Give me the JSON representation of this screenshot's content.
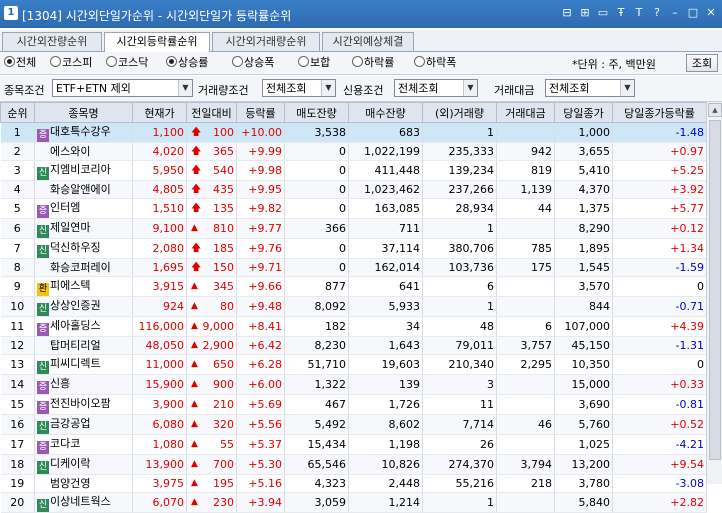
{
  "window": {
    "num": "1",
    "title": "[1304] 시간외단일가순위 - 시간외단일가 등락률순위",
    "controls": [
      "⊟",
      "⊞",
      "▭",
      "Ŧ",
      "T",
      "?",
      "–",
      "□",
      "✕"
    ]
  },
  "tabs": [
    {
      "label": "시간외잔량순위",
      "active": false
    },
    {
      "label": "시간외등락률순위",
      "active": true
    },
    {
      "label": "시간외거래량순위",
      "active": false
    },
    {
      "label": "시간외예상체결",
      "active": false
    }
  ],
  "market_radios": [
    {
      "label": "전체",
      "on": true
    },
    {
      "label": "코스피",
      "on": false
    },
    {
      "label": "코스닥",
      "on": false
    }
  ],
  "sort_radios": [
    {
      "label": "상승률",
      "on": true
    },
    {
      "label": "상승폭",
      "on": false
    },
    {
      "label": "보합",
      "on": false
    },
    {
      "label": "하락률",
      "on": false
    },
    {
      "label": "하락폭",
      "on": false
    }
  ],
  "unit_text": "*단위 : 주, 백만원",
  "query_button": "조회",
  "filters": {
    "stock_cond_label": "종목조건",
    "stock_cond_value": "ETF+ETN 제외",
    "volume_cond_label": "거래량조건",
    "volume_cond_value": "전체조회",
    "credit_cond_label": "신용조건",
    "credit_cond_value": "전체조회",
    "amount_label": "거래대금",
    "amount_value": "전체조회"
  },
  "columns": [
    "순위",
    "종목명",
    "현재가",
    "전일대비",
    "등락률",
    "매도잔량",
    "매수잔량",
    "(외)거래량",
    "거래대금",
    "당일종가",
    "당일종가등락률"
  ],
  "rows": [
    {
      "rank": "1",
      "badge": "증",
      "name": "대호특수강우",
      "price": "1,100",
      "sign": "arrow",
      "diff": "100",
      "rate": "+10.00",
      "sell": "3,538",
      "buy": "683",
      "vol": "1",
      "amt": "",
      "close": "1,000",
      "crate": "-1.48"
    },
    {
      "rank": "2",
      "badge": "",
      "name": "에스와이",
      "price": "4,020",
      "sign": "arrow",
      "diff": "365",
      "rate": "+9.99",
      "sell": "0",
      "buy": "1,022,199",
      "vol": "235,333",
      "amt": "942",
      "close": "3,655",
      "crate": "+0.97"
    },
    {
      "rank": "3",
      "badge": "신",
      "name": "지엠비코리아",
      "price": "5,950",
      "sign": "arrow",
      "diff": "540",
      "rate": "+9.98",
      "sell": "0",
      "buy": "411,448",
      "vol": "139,234",
      "amt": "819",
      "close": "5,410",
      "crate": "+5.25"
    },
    {
      "rank": "4",
      "badge": "",
      "name": "화승알앤에이",
      "price": "4,805",
      "sign": "arrow",
      "diff": "435",
      "rate": "+9.95",
      "sell": "0",
      "buy": "1,023,462",
      "vol": "237,266",
      "amt": "1,139",
      "close": "4,370",
      "crate": "+3.92"
    },
    {
      "rank": "5",
      "badge": "증",
      "name": "인터엠",
      "price": "1,510",
      "sign": "arrow",
      "diff": "135",
      "rate": "+9.82",
      "sell": "0",
      "buy": "163,085",
      "vol": "28,934",
      "amt": "44",
      "close": "1,375",
      "crate": "+5.77"
    },
    {
      "rank": "6",
      "badge": "신",
      "name": "제일연마",
      "price": "9,100",
      "sign": "tri",
      "diff": "810",
      "rate": "+9.77",
      "sell": "366",
      "buy": "711",
      "vol": "1",
      "amt": "",
      "close": "8,290",
      "crate": "+0.12"
    },
    {
      "rank": "7",
      "badge": "신",
      "name": "덕신하우징",
      "price": "2,080",
      "sign": "arrow",
      "diff": "185",
      "rate": "+9.76",
      "sell": "0",
      "buy": "37,114",
      "vol": "380,706",
      "amt": "785",
      "close": "1,895",
      "crate": "+1.34"
    },
    {
      "rank": "8",
      "badge": "",
      "name": "화승코퍼레이",
      "price": "1,695",
      "sign": "arrow",
      "diff": "150",
      "rate": "+9.71",
      "sell": "0",
      "buy": "162,014",
      "vol": "103,736",
      "amt": "175",
      "close": "1,545",
      "crate": "-1.59"
    },
    {
      "rank": "9",
      "badge": "환",
      "name": "피에스텍",
      "price": "3,915",
      "sign": "tri",
      "diff": "345",
      "rate": "+9.66",
      "sell": "877",
      "buy": "641",
      "vol": "6",
      "amt": "",
      "close": "3,570",
      "crate": "0"
    },
    {
      "rank": "10",
      "badge": "신",
      "name": "상상인증권",
      "price": "924",
      "sign": "tri",
      "diff": "80",
      "rate": "+9.48",
      "sell": "8,092",
      "buy": "5,933",
      "vol": "1",
      "amt": "",
      "close": "844",
      "crate": "-0.71"
    },
    {
      "rank": "11",
      "badge": "증",
      "name": "세아홀딩스",
      "price": "116,000",
      "sign": "tri",
      "diff": "9,000",
      "rate": "+8.41",
      "sell": "182",
      "buy": "34",
      "vol": "48",
      "amt": "6",
      "close": "107,000",
      "crate": "+4.39"
    },
    {
      "rank": "12",
      "badge": "",
      "name": "탑머티리얼",
      "price": "48,050",
      "sign": "tri",
      "diff": "2,900",
      "rate": "+6.42",
      "sell": "8,230",
      "buy": "1,643",
      "vol": "79,011",
      "amt": "3,757",
      "close": "45,150",
      "crate": "-1.31"
    },
    {
      "rank": "13",
      "badge": "신",
      "name": "피씨디렉트",
      "price": "11,000",
      "sign": "tri",
      "diff": "650",
      "rate": "+6.28",
      "sell": "51,710",
      "buy": "19,603",
      "vol": "210,340",
      "amt": "2,295",
      "close": "10,350",
      "crate": "0"
    },
    {
      "rank": "14",
      "badge": "증",
      "name": "신흥",
      "price": "15,900",
      "sign": "tri",
      "diff": "900",
      "rate": "+6.00",
      "sell": "1,322",
      "buy": "139",
      "vol": "3",
      "amt": "",
      "close": "15,000",
      "crate": "+0.33"
    },
    {
      "rank": "15",
      "badge": "증",
      "name": "전진바이오팜",
      "price": "3,900",
      "sign": "tri",
      "diff": "210",
      "rate": "+5.69",
      "sell": "467",
      "buy": "1,726",
      "vol": "11",
      "amt": "",
      "close": "3,690",
      "crate": "-0.81"
    },
    {
      "rank": "16",
      "badge": "신",
      "name": "금강공업",
      "price": "6,080",
      "sign": "tri",
      "diff": "320",
      "rate": "+5.56",
      "sell": "5,492",
      "buy": "8,602",
      "vol": "7,714",
      "amt": "46",
      "close": "5,760",
      "crate": "+0.52"
    },
    {
      "rank": "17",
      "badge": "증",
      "name": "코다코",
      "price": "1,080",
      "sign": "tri",
      "diff": "55",
      "rate": "+5.37",
      "sell": "15,434",
      "buy": "1,198",
      "vol": "26",
      "amt": "",
      "close": "1,025",
      "crate": "-4.21"
    },
    {
      "rank": "18",
      "badge": "신",
      "name": "디케이락",
      "price": "13,900",
      "sign": "tri",
      "diff": "700",
      "rate": "+5.30",
      "sell": "65,546",
      "buy": "10,826",
      "vol": "274,370",
      "amt": "3,794",
      "close": "13,200",
      "crate": "+9.54"
    },
    {
      "rank": "19",
      "badge": "",
      "name": "범양건영",
      "price": "3,975",
      "sign": "tri",
      "diff": "195",
      "rate": "+5.16",
      "sell": "4,323",
      "buy": "2,448",
      "vol": "55,216",
      "amt": "218",
      "close": "3,780",
      "crate": "-3.08"
    },
    {
      "rank": "20",
      "badge": "신",
      "name": "이상네트웍스",
      "price": "6,070",
      "sign": "tri",
      "diff": "230",
      "rate": "+3.94",
      "sell": "3,059",
      "buy": "1,214",
      "vol": "1",
      "amt": "",
      "close": "5,840",
      "crate": "+2.82"
    }
  ]
}
